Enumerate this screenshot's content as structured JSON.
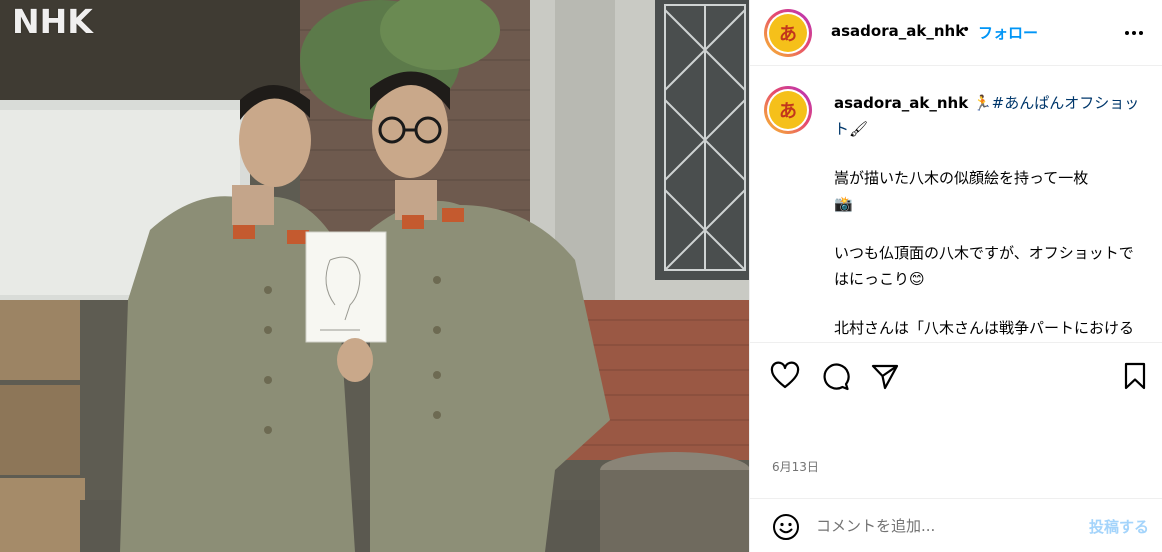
{
  "photo": {
    "watermark": "NHK",
    "alt_subject": "two-soldiers-holding-portrait-sketch"
  },
  "post": {
    "username": "asadora_ak_nhk",
    "avatar_glyph": "あ",
    "follow_label": "フォロー",
    "separator": "•",
    "caption": {
      "username": "asadora_ak_nhk",
      "lead_emoji": "🏃",
      "hashtag": "#あんぱんオフショット",
      "tail_emoji": "🖌",
      "line1": "嵩が描いた八木の似顔絵を持って一枚",
      "line1_emoji": "📸",
      "line2": "いつも仏頂面の八木ですが、オフショットではにっこり",
      "line2_emoji": "😊",
      "line3": "北村さんは「八木さんは戦争パートにおけるのぶ的な存在」だとお話しされ"
    },
    "date": "6月13日"
  },
  "comment": {
    "placeholder": "コメントを追加...",
    "post_label": "投稿する"
  },
  "icons": {
    "more": "more-horizontal-icon",
    "like": "heart-icon",
    "comment": "comment-bubble-icon",
    "share": "paper-plane-icon",
    "save": "bookmark-icon",
    "emoji": "smiley-icon"
  },
  "colors": {
    "link_blue": "#0095f6",
    "hashtag": "#00376b",
    "muted": "#737373",
    "post_disabled": "#a4d4fb",
    "avatar_yellow": "#f5c01a"
  }
}
